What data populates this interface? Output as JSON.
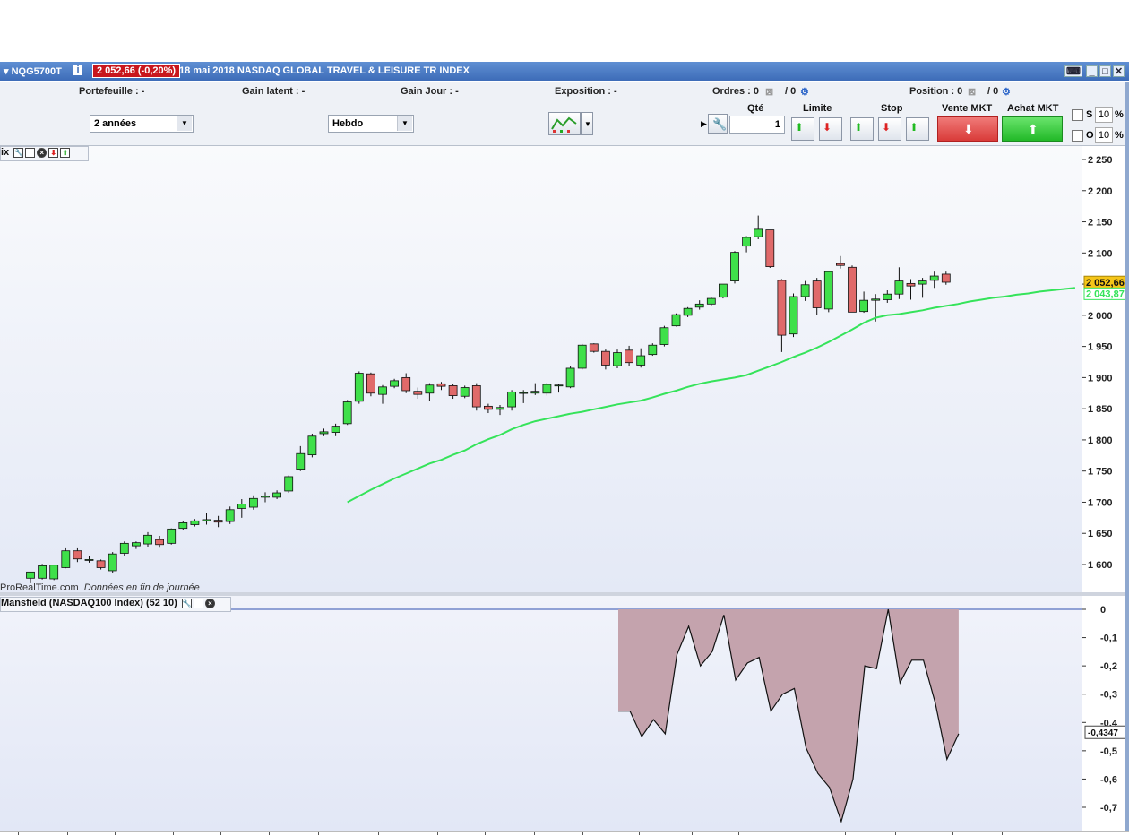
{
  "window": {
    "ticker": "NQG5700T",
    "info_icon": "i",
    "price_badge": "2 052,66 (-0,20%)",
    "date_name": "18 mai 2018 NASDAQ GLOBAL TRAVEL & LEISURE TR INDEX"
  },
  "infobar": {
    "portefeuille": "Portefeuille : -",
    "gain_latent": "Gain latent : -",
    "gain_jour": "Gain Jour : -",
    "exposition": "Exposition : -",
    "ordres_label": "Ordres : 0",
    "ordres_sep": "/ 0",
    "position_label": "Position : 0",
    "position_sep": "/ 0"
  },
  "toolbar": {
    "period": "2 années",
    "interval": "Hebdo",
    "qty_label": "Qté",
    "qty_value": "1",
    "limit_label": "Limite",
    "stop_label": "Stop",
    "sell_label": "Vente MKT",
    "buy_label": "Achat MKT",
    "s_label": "S",
    "o_label": "O",
    "s_value": "10",
    "o_value": "10",
    "pct": "%"
  },
  "main_panel": {
    "tools_label": "ix",
    "source": "ProRealTime.com",
    "source_note": "Données en fin de journée"
  },
  "sub_panel": {
    "title": "Mansfield (NASDAQ100 Index) (52 10)"
  },
  "colors": {
    "up": "#3fe04a",
    "down": "#e06a6a",
    "ma": "#35e35a",
    "rs_fill": "#c4a3ad",
    "price_tag": "#f5c518"
  },
  "chart_data": [
    {
      "type": "candlestick",
      "ylim": [
        1570,
        2265
      ],
      "y_ticks": [
        "2 250",
        "2 200",
        "2 150",
        "2 100",
        "2 050",
        "2 000",
        "1 950",
        "1 900",
        "1 850",
        "1 800",
        "1 750",
        "1 700",
        "1 650",
        "1 600"
      ],
      "y_tick_values": [
        2250,
        2200,
        2150,
        2100,
        2050,
        2000,
        1950,
        1900,
        1850,
        1800,
        1750,
        1700,
        1650,
        1600
      ],
      "last_price_label": "2 052,66",
      "last_price": 2052.66,
      "ma_label": "2 043,87",
      "ma_value": 2043.87,
      "candles": [
        {
          "o": 1578,
          "h": 1588,
          "l": 1570,
          "c": 1588
        },
        {
          "o": 1578,
          "h": 1601,
          "l": 1576,
          "c": 1598
        },
        {
          "o": 1577,
          "h": 1600,
          "l": 1575,
          "c": 1599
        },
        {
          "o": 1595,
          "h": 1626,
          "l": 1594,
          "c": 1622
        },
        {
          "o": 1622,
          "h": 1626,
          "l": 1604,
          "c": 1609
        },
        {
          "o": 1607,
          "h": 1613,
          "l": 1603,
          "c": 1608
        },
        {
          "o": 1606,
          "h": 1608,
          "l": 1592,
          "c": 1595
        },
        {
          "o": 1590,
          "h": 1620,
          "l": 1586,
          "c": 1617
        },
        {
          "o": 1618,
          "h": 1637,
          "l": 1614,
          "c": 1634
        },
        {
          "o": 1630,
          "h": 1637,
          "l": 1625,
          "c": 1635
        },
        {
          "o": 1633,
          "h": 1652,
          "l": 1628,
          "c": 1647
        },
        {
          "o": 1640,
          "h": 1646,
          "l": 1627,
          "c": 1632
        },
        {
          "o": 1634,
          "h": 1658,
          "l": 1632,
          "c": 1657
        },
        {
          "o": 1658,
          "h": 1670,
          "l": 1656,
          "c": 1667
        },
        {
          "o": 1664,
          "h": 1673,
          "l": 1661,
          "c": 1670
        },
        {
          "o": 1670,
          "h": 1682,
          "l": 1664,
          "c": 1672
        },
        {
          "o": 1671,
          "h": 1678,
          "l": 1660,
          "c": 1668
        },
        {
          "o": 1669,
          "h": 1693,
          "l": 1665,
          "c": 1688
        },
        {
          "o": 1690,
          "h": 1705,
          "l": 1675,
          "c": 1697
        },
        {
          "o": 1692,
          "h": 1711,
          "l": 1688,
          "c": 1706
        },
        {
          "o": 1708,
          "h": 1716,
          "l": 1700,
          "c": 1710
        },
        {
          "o": 1708,
          "h": 1719,
          "l": 1705,
          "c": 1715
        },
        {
          "o": 1718,
          "h": 1743,
          "l": 1715,
          "c": 1741
        },
        {
          "o": 1753,
          "h": 1790,
          "l": 1750,
          "c": 1778
        },
        {
          "o": 1776,
          "h": 1810,
          "l": 1772,
          "c": 1806
        },
        {
          "o": 1810,
          "h": 1818,
          "l": 1806,
          "c": 1813
        },
        {
          "o": 1812,
          "h": 1826,
          "l": 1806,
          "c": 1822
        },
        {
          "o": 1826,
          "h": 1864,
          "l": 1824,
          "c": 1861
        },
        {
          "o": 1862,
          "h": 1910,
          "l": 1858,
          "c": 1907
        },
        {
          "o": 1906,
          "h": 1908,
          "l": 1870,
          "c": 1875
        },
        {
          "o": 1873,
          "h": 1888,
          "l": 1858,
          "c": 1885
        },
        {
          "o": 1886,
          "h": 1898,
          "l": 1883,
          "c": 1895
        },
        {
          "o": 1900,
          "h": 1907,
          "l": 1875,
          "c": 1879
        },
        {
          "o": 1878,
          "h": 1884,
          "l": 1866,
          "c": 1873
        },
        {
          "o": 1875,
          "h": 1891,
          "l": 1863,
          "c": 1888
        },
        {
          "o": 1890,
          "h": 1893,
          "l": 1880,
          "c": 1886
        },
        {
          "o": 1887,
          "h": 1890,
          "l": 1866,
          "c": 1871
        },
        {
          "o": 1870,
          "h": 1887,
          "l": 1867,
          "c": 1884
        },
        {
          "o": 1887,
          "h": 1891,
          "l": 1847,
          "c": 1853
        },
        {
          "o": 1854,
          "h": 1858,
          "l": 1843,
          "c": 1849
        },
        {
          "o": 1849,
          "h": 1856,
          "l": 1840,
          "c": 1852
        },
        {
          "o": 1853,
          "h": 1880,
          "l": 1847,
          "c": 1877
        },
        {
          "o": 1875,
          "h": 1880,
          "l": 1859,
          "c": 1876
        },
        {
          "o": 1875,
          "h": 1891,
          "l": 1872,
          "c": 1878
        },
        {
          "o": 1875,
          "h": 1892,
          "l": 1871,
          "c": 1889
        },
        {
          "o": 1887,
          "h": 1889,
          "l": 1876,
          "c": 1888
        },
        {
          "o": 1885,
          "h": 1918,
          "l": 1883,
          "c": 1915
        },
        {
          "o": 1915,
          "h": 1954,
          "l": 1913,
          "c": 1952
        },
        {
          "o": 1954,
          "h": 1955,
          "l": 1940,
          "c": 1942
        },
        {
          "o": 1942,
          "h": 1945,
          "l": 1913,
          "c": 1920
        },
        {
          "o": 1919,
          "h": 1945,
          "l": 1915,
          "c": 1940
        },
        {
          "o": 1944,
          "h": 1951,
          "l": 1918,
          "c": 1924
        },
        {
          "o": 1920,
          "h": 1947,
          "l": 1916,
          "c": 1935
        },
        {
          "o": 1937,
          "h": 1955,
          "l": 1935,
          "c": 1952
        },
        {
          "o": 1953,
          "h": 1983,
          "l": 1950,
          "c": 1980
        },
        {
          "o": 1983,
          "h": 2003,
          "l": 1982,
          "c": 2001
        },
        {
          "o": 2000,
          "h": 2013,
          "l": 1997,
          "c": 2011
        },
        {
          "o": 2013,
          "h": 2024,
          "l": 2009,
          "c": 2018
        },
        {
          "o": 2018,
          "h": 2030,
          "l": 2015,
          "c": 2027
        },
        {
          "o": 2029,
          "h": 2050,
          "l": 2027,
          "c": 2050
        },
        {
          "o": 2055,
          "h": 2103,
          "l": 2051,
          "c": 2101
        },
        {
          "o": 2111,
          "h": 2127,
          "l": 2101,
          "c": 2125
        },
        {
          "o": 2126,
          "h": 2160,
          "l": 2122,
          "c": 2138
        },
        {
          "o": 2137,
          "h": 2137,
          "l": 2076,
          "c": 2078
        },
        {
          "o": 2056,
          "h": 2058,
          "l": 1941,
          "c": 1968
        },
        {
          "o": 1970,
          "h": 2035,
          "l": 1965,
          "c": 2030
        },
        {
          "o": 2030,
          "h": 2055,
          "l": 2023,
          "c": 2049
        },
        {
          "o": 2055,
          "h": 2060,
          "l": 2000,
          "c": 2012
        },
        {
          "o": 2010,
          "h": 2071,
          "l": 2005,
          "c": 2070
        },
        {
          "o": 2083,
          "h": 2095,
          "l": 2075,
          "c": 2080
        },
        {
          "o": 2077,
          "h": 2080,
          "l": 2005,
          "c": 2005
        },
        {
          "o": 2006,
          "h": 2038,
          "l": 2004,
          "c": 2024
        },
        {
          "o": 2024,
          "h": 2034,
          "l": 1990,
          "c": 2026
        },
        {
          "o": 2025,
          "h": 2040,
          "l": 2020,
          "c": 2034
        },
        {
          "o": 2034,
          "h": 2077,
          "l": 2026,
          "c": 2055
        },
        {
          "o": 2051,
          "h": 2058,
          "l": 2025,
          "c": 2047
        },
        {
          "o": 2050,
          "h": 2060,
          "l": 2028,
          "c": 2055
        },
        {
          "o": 2056,
          "h": 2070,
          "l": 2044,
          "c": 2063
        },
        {
          "o": 2066,
          "h": 2070,
          "l": 2049,
          "c": 2053
        }
      ],
      "ma_series": [
        1700,
        1710,
        1720,
        1729,
        1738,
        1746,
        1754,
        1762,
        1768,
        1776,
        1783,
        1793,
        1801,
        1808,
        1817,
        1824,
        1830,
        1834,
        1838,
        1842,
        1845,
        1849,
        1853,
        1857,
        1860,
        1863,
        1868,
        1874,
        1879,
        1885,
        1890,
        1894,
        1897,
        1900,
        1904,
        1911,
        1918,
        1925,
        1933,
        1940,
        1948,
        1957,
        1967,
        1977,
        1988,
        1996,
        2000,
        2002,
        2005,
        2008,
        2012,
        2015,
        2018,
        2022,
        2025,
        2028,
        2030,
        2033,
        2035,
        2038,
        2040,
        2042,
        2044
      ]
    },
    {
      "type": "area",
      "ylim": [
        -0.75,
        0.02
      ],
      "y_ticks": [
        "0",
        "-0,1",
        "-0,2",
        "-0,3",
        "-0,4",
        "-0,5",
        "-0,6",
        "-0,7"
      ],
      "y_tick_values": [
        0,
        -0.1,
        -0.2,
        -0.3,
        -0.4,
        -0.5,
        -0.6,
        -0.7
      ],
      "last_value_label": "-0,4347",
      "last_value": -0.4347,
      "values": [
        -0.36,
        -0.36,
        -0.45,
        -0.39,
        -0.44,
        -0.16,
        -0.06,
        -0.2,
        -0.15,
        -0.02,
        -0.25,
        -0.19,
        -0.17,
        -0.36,
        -0.3,
        -0.28,
        -0.49,
        -0.58,
        -0.63,
        -0.75,
        -0.6,
        -0.2,
        -0.21,
        0.0,
        -0.26,
        -0.18,
        -0.18,
        -0.33,
        -0.53,
        -0.44
      ]
    }
  ]
}
